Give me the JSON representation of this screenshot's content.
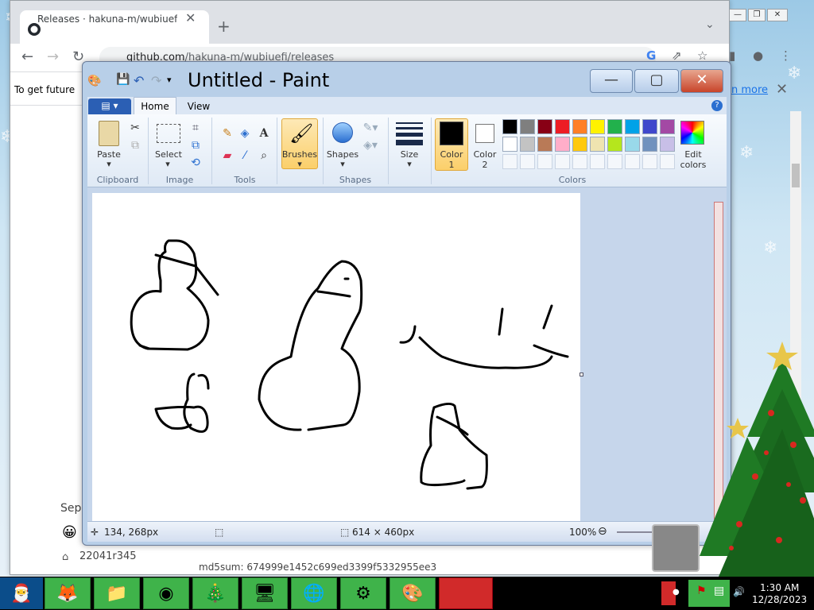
{
  "browser": {
    "tab_title": "Releases · hakuna-m/wubiuefi · C",
    "new_tab": "+",
    "url_domain": "github.com",
    "url_path": "/hakuna-m/wubiuefi/releases",
    "infobar_text": "To get future",
    "learn_more": "n more",
    "page_partial_text": "Sep",
    "tag_label": "22041r345",
    "md5_partial": "md5sum: 674999e1452c699ed3399f5332955ee3"
  },
  "paint": {
    "title": "Untitled - Paint",
    "tabs": [
      "Home",
      "View"
    ],
    "groups": {
      "clipboard": "Clipboard",
      "image": "Image",
      "tools": "Tools",
      "shapes": "Shapes",
      "colors": "Colors"
    },
    "buttons": {
      "paste": "Paste",
      "select": "Select",
      "brushes": "Brushes",
      "shapes": "Shapes",
      "size": "Size",
      "color1_line1": "Color",
      "color1_line2": "1",
      "color2_line1": "Color",
      "color2_line2": "2",
      "edit_colors_line1": "Edit",
      "edit_colors_line2": "colors"
    },
    "palette_row1": [
      "#000000",
      "#7f7f7f",
      "#880015",
      "#ed1c24",
      "#ff7f27",
      "#fff200",
      "#22b14c",
      "#00a2e8",
      "#3f48cc",
      "#a349a4"
    ],
    "palette_row2": [
      "#ffffff",
      "#c3c3c3",
      "#b97a57",
      "#ffaec9",
      "#ffc90e",
      "#efe4b0",
      "#b5e61d",
      "#99d9ea",
      "#7092be",
      "#c8bfe7"
    ],
    "color1": "#000000",
    "color2": "#ffffff",
    "status": {
      "cursor_pos": "134, 268px",
      "canvas_size": "614 × 460px",
      "zoom": "100%"
    }
  },
  "taskbar": {
    "time": "1:30 AM",
    "date": "12/28/2023"
  }
}
